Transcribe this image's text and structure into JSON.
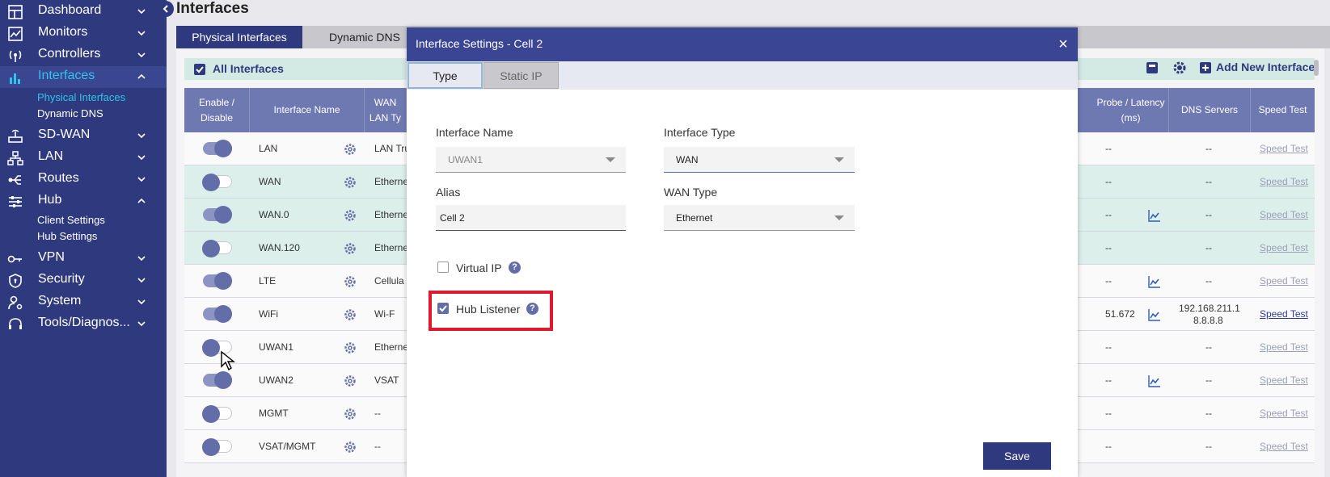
{
  "sidebar": {
    "items": [
      {
        "label": "Dashboard"
      },
      {
        "label": "Monitors"
      },
      {
        "label": "Controllers"
      },
      {
        "label": "Interfaces"
      },
      {
        "label": "SD-WAN"
      },
      {
        "label": "LAN"
      },
      {
        "label": "Routes"
      },
      {
        "label": "Hub"
      },
      {
        "label": "VPN"
      },
      {
        "label": "Security"
      },
      {
        "label": "System"
      },
      {
        "label": "Tools/Diagnos..."
      }
    ],
    "interfaces_sub": [
      "Physical Interfaces",
      "Dynamic DNS"
    ],
    "hub_sub": [
      "Client Settings",
      "Hub Settings"
    ],
    "accent_color": "#2ec4ee",
    "bg_color": "#2f3a7e"
  },
  "page": {
    "title": "Interfaces",
    "tabs": [
      "Physical Interfaces",
      "Dynamic DNS"
    ],
    "all_interfaces_label": "All Interfaces",
    "add_new_label": "Add New Interface"
  },
  "table": {
    "headers": {
      "enable": "Enable / Disable",
      "name": "Interface Name",
      "wan": "WAN",
      "lan_type": "LAN Ty",
      "probe": "Probe / Latency (ms)",
      "dns": "DNS Servers",
      "speed": "Speed Test"
    },
    "rows": [
      {
        "name": "LAN",
        "type": "LAN Tru",
        "probe": "--",
        "dns": "--",
        "speed": "Speed Test",
        "enabled": true
      },
      {
        "name": "WAN",
        "type": "Etherne",
        "probe": "--",
        "dns": "--",
        "speed": "Speed Test",
        "enabled": false
      },
      {
        "name": "WAN.0",
        "type": "Etherne",
        "probe": "--",
        "dns": "--",
        "speed": "Speed Test",
        "enabled": true
      },
      {
        "name": "WAN.120",
        "type": "Etherne",
        "probe": "--",
        "dns": "--",
        "speed": "Speed Test",
        "enabled": false
      },
      {
        "name": "LTE",
        "type": "Cellula",
        "probe": "--",
        "dns": "--",
        "speed": "Speed Test",
        "enabled": true
      },
      {
        "name": "WiFi",
        "type": "Wi-F",
        "probe": "51.672",
        "dns": "192.168.211.1",
        "dns2": "8.8.8.8",
        "speed": "Speed Test",
        "enabled": true
      },
      {
        "name": "UWAN1",
        "type": "Etherne",
        "probe": "--",
        "dns": "--",
        "speed": "Speed Test",
        "enabled": false
      },
      {
        "name": "UWAN2",
        "type": "VSAT",
        "probe": "--",
        "dns": "--",
        "speed": "Speed Test",
        "enabled": true
      },
      {
        "name": "MGMT",
        "type": "--",
        "probe": "--",
        "dns": "--",
        "speed": "Speed Test",
        "enabled": false
      },
      {
        "name": "VSAT/MGMT",
        "type": "--",
        "probe": "--",
        "dns": "--",
        "speed": "Speed Test",
        "enabled": false
      }
    ]
  },
  "modal": {
    "title": "Interface Settings - Cell 2",
    "close": "×",
    "tabs": [
      "Type",
      "Static IP"
    ],
    "interface_name_label": "Interface Name",
    "interface_name_value": "UWAN1",
    "interface_type_label": "Interface Type",
    "interface_type_value": "WAN",
    "alias_label": "Alias",
    "alias_value": "Cell 2",
    "wan_type_label": "WAN Type",
    "wan_type_value": "Ethernet",
    "virtual_ip_label": "Virtual IP",
    "virtual_ip_checked": false,
    "hub_listener_label": "Hub Listener",
    "hub_listener_checked": true,
    "help": "?",
    "save_label": "Save"
  },
  "colors": {
    "primary": "#2f3a7e",
    "highlight": "#e0182d"
  }
}
